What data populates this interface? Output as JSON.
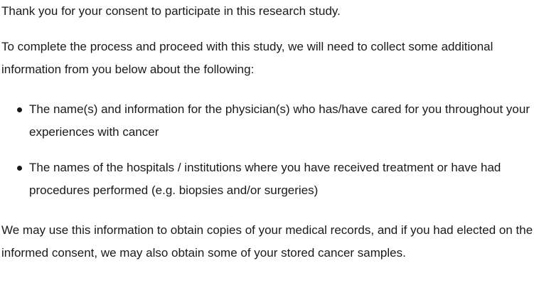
{
  "intro": "Thank you for your consent to participate in this research study.",
  "instructions": "To complete the process and proceed with this study, we will need to collect some additional information from you below about the following:",
  "bullets": [
    "The name(s) and information for the physician(s) who has/have cared for you throughout your experiences with cancer",
    "The names of the hospitals / institutions where you have received treatment or have had procedures performed (e.g. biopsies and/or surgeries)"
  ],
  "closing": "We may use this information to obtain copies of your medical records, and if you had elected on the informed consent, we may also obtain some of your stored cancer samples."
}
